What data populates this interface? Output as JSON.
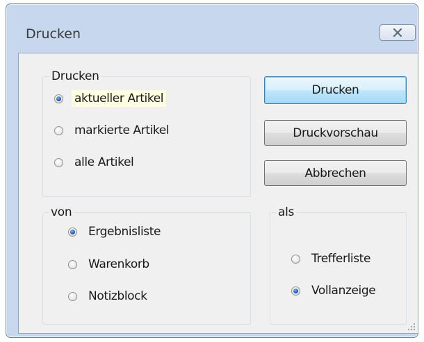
{
  "window": {
    "title": "Drucken"
  },
  "print_group": {
    "label": "Drucken",
    "options": [
      {
        "label": "aktueller Artikel",
        "checked": true
      },
      {
        "label": "markierte Artikel",
        "checked": false
      },
      {
        "label": "alle Artikel",
        "checked": false
      }
    ]
  },
  "from_group": {
    "label": "von",
    "options": [
      {
        "label": "Ergebnisliste",
        "checked": true
      },
      {
        "label": "Warenkorb",
        "checked": false
      },
      {
        "label": "Notizblock",
        "checked": false
      }
    ]
  },
  "as_group": {
    "label": "als",
    "options": [
      {
        "label": "Trefferliste",
        "checked": false
      },
      {
        "label": "Vollanzeige",
        "checked": true
      }
    ]
  },
  "buttons": {
    "print": "Drucken",
    "preview": "Druckvorschau",
    "cancel": "Abbrechen"
  }
}
